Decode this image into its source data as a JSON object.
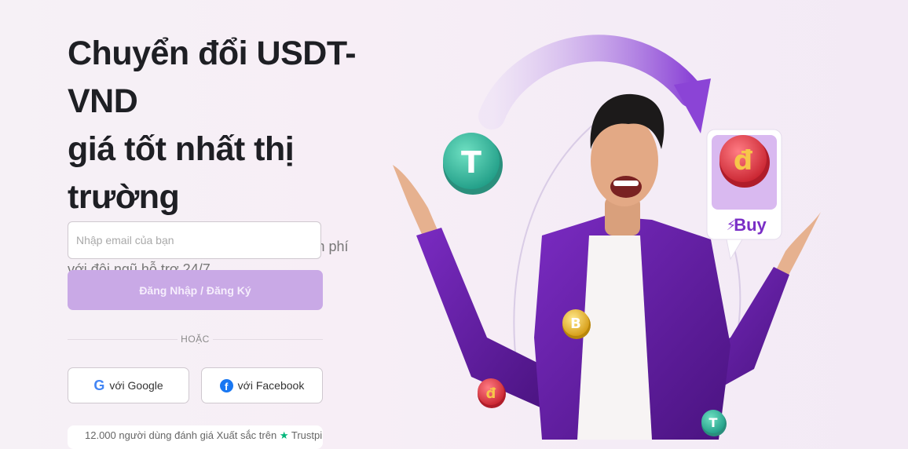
{
  "hero": {
    "title_line1": "Chuyển đổi USDT-VND",
    "title_line2": "giá tốt nhất thị trường",
    "subtitle": "Trải nghiệm nạp rút VND hoàn toàn miễn phí với đội ngũ hỗ trợ 24/7."
  },
  "form": {
    "email_placeholder": "Nhập email của bạn",
    "login_label": "Đăng Nhập / Đăng Ký",
    "divider_text": "HOẶC",
    "google_label": "với Google",
    "facebook_label": "với Facebook"
  },
  "trust": {
    "text": "12.000 người dùng đánh giá Xuất sắc trên",
    "brand": "Trustpilot"
  },
  "illustration": {
    "buy_label": "Buy",
    "coin_symbol_dong": "đ",
    "coin_symbol_tether": "T",
    "coin_symbol_bitcoin": "B"
  },
  "colors": {
    "primary": "#8a3fd0",
    "button_disabled": "#c9a9e6",
    "background": "#f6f0f6",
    "tether": "#3fc1a5",
    "dong_coin": "#e0414e"
  }
}
